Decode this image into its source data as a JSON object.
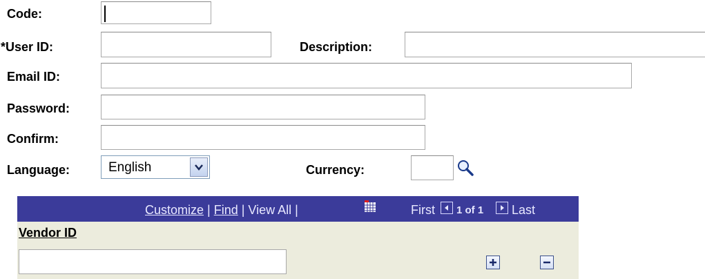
{
  "form": {
    "code_label": "Code:",
    "code_value": "",
    "userid_label": "*User ID:",
    "userid_value": "",
    "description_label": "Description:",
    "description_value": "",
    "email_label": "Email ID:",
    "email_value": "",
    "password_label": "Password:",
    "password_value": "",
    "confirm_label": "Confirm:",
    "confirm_value": "",
    "language_label": "Language:",
    "language_value": "English",
    "currency_label": "Currency:",
    "currency_value": ""
  },
  "grid": {
    "customize": "Customize",
    "sep1": " | ",
    "find": "Find",
    "sep2": " | ",
    "view_all": "View All",
    "sep3": " | ",
    "first": "First",
    "page_info": "1 of 1",
    "last": "Last",
    "column_header": "Vendor ID",
    "vendor_value": ""
  },
  "icons": {
    "lookup": "magnifier-icon",
    "download": "grid-download-icon",
    "first": "first-arrow-icon",
    "last": "last-arrow-icon",
    "add": "plus-icon",
    "remove": "minus-icon",
    "dropdown": "chevron-down-icon"
  },
  "colors": {
    "grid_header": "#3b3b9a",
    "grid_body": "#ececdd"
  }
}
